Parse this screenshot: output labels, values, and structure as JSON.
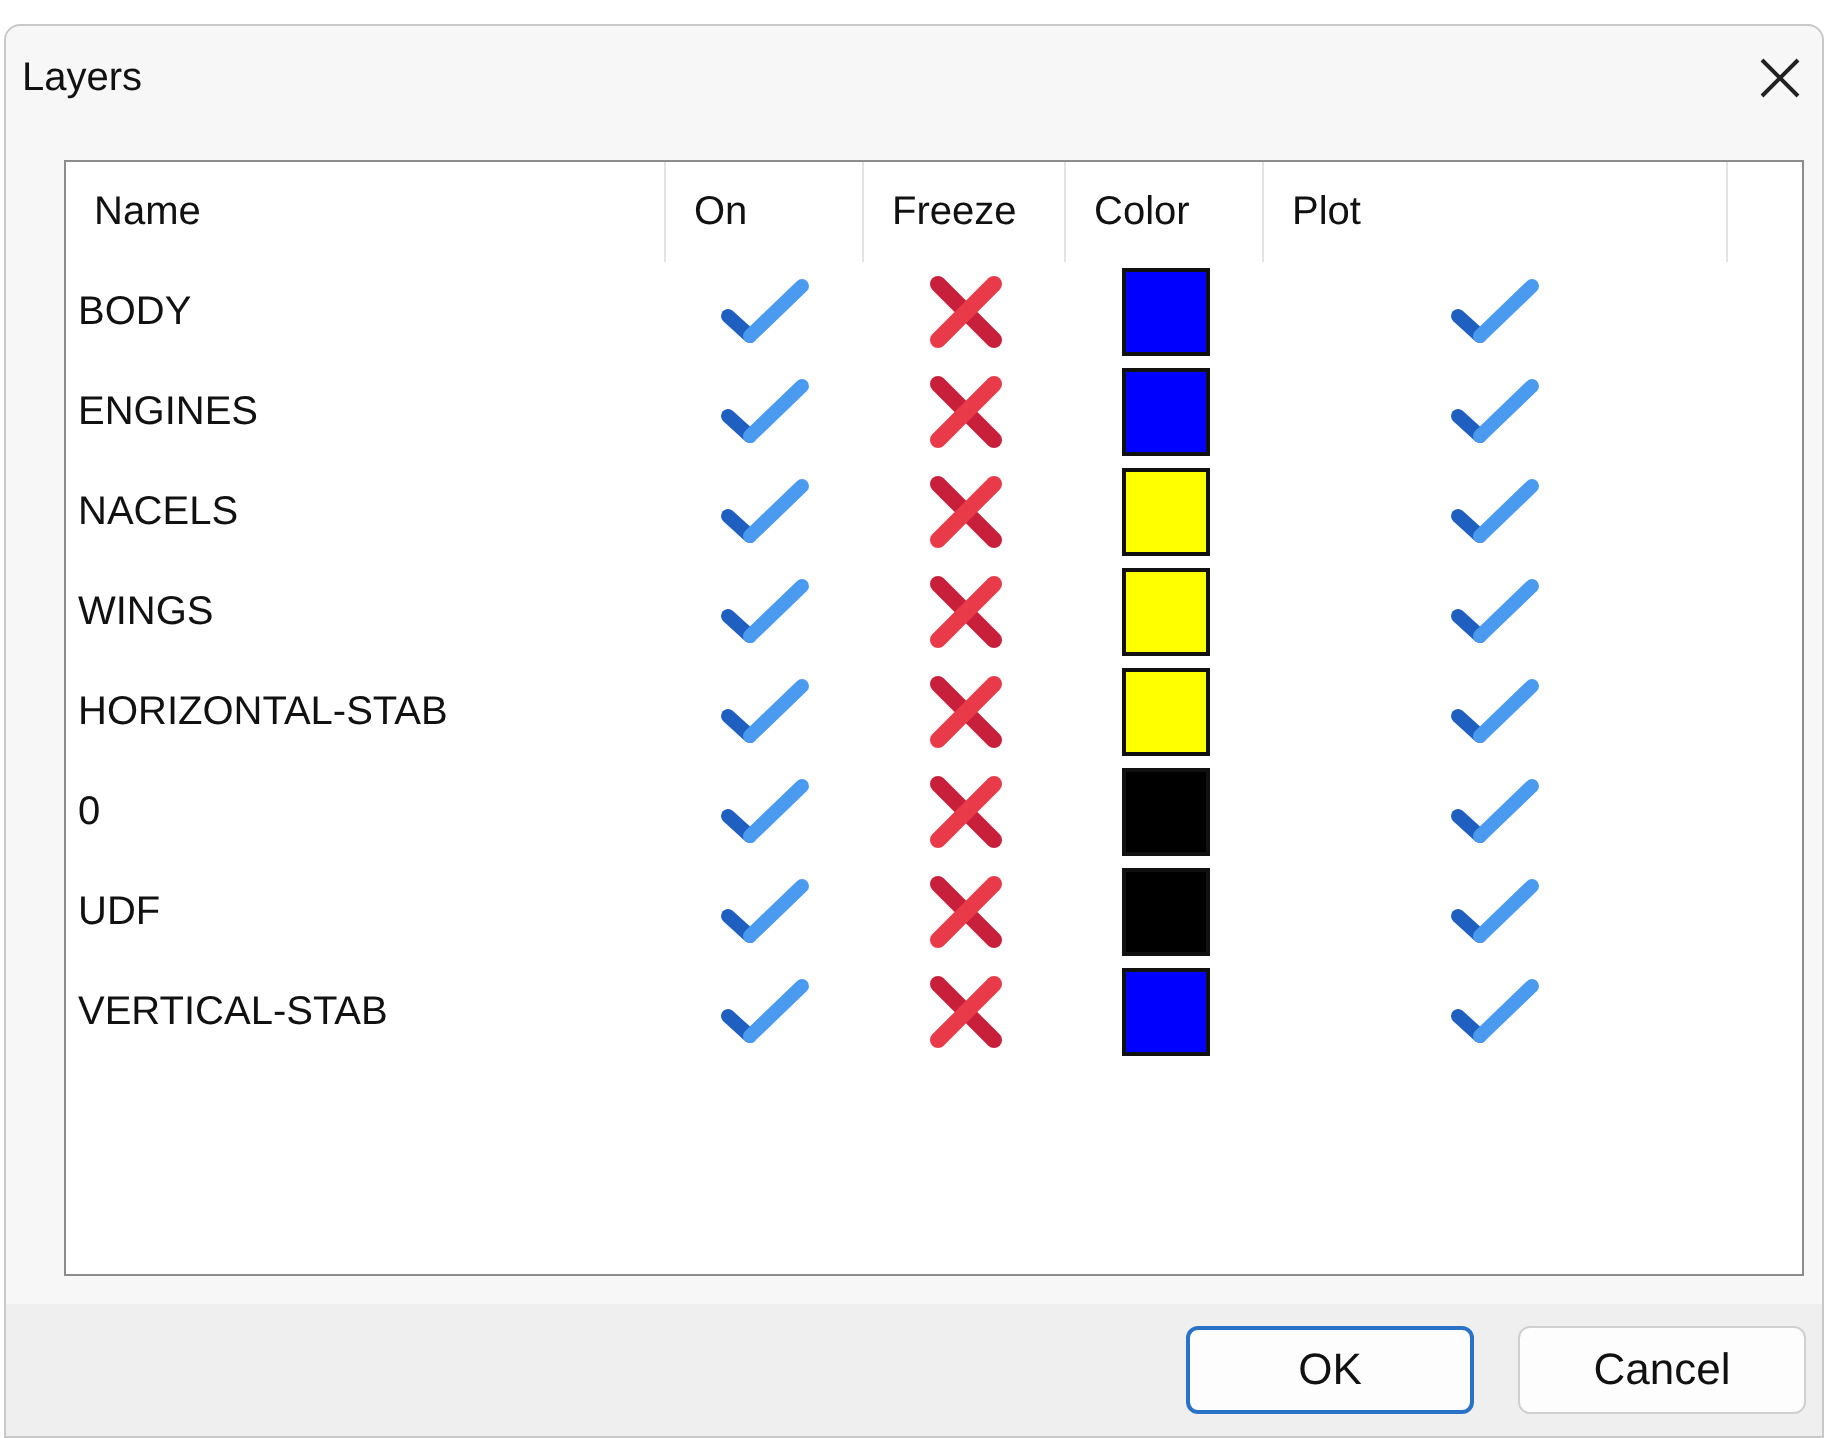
{
  "window": {
    "title": "Layers"
  },
  "table": {
    "columns": [
      "Name",
      "On",
      "Freeze",
      "Color",
      "Plot"
    ],
    "rows": [
      {
        "name": "BODY",
        "on": true,
        "freeze": false,
        "color": "#0000ff",
        "plot": true
      },
      {
        "name": "ENGINES",
        "on": true,
        "freeze": false,
        "color": "#0000ff",
        "plot": true
      },
      {
        "name": "NACELS",
        "on": true,
        "freeze": false,
        "color": "#ffff00",
        "plot": true
      },
      {
        "name": "WINGS",
        "on": true,
        "freeze": false,
        "color": "#ffff00",
        "plot": true
      },
      {
        "name": "HORIZONTAL-STAB",
        "on": true,
        "freeze": false,
        "color": "#ffff00",
        "plot": true
      },
      {
        "name": "0",
        "on": true,
        "freeze": false,
        "color": "#000000",
        "plot": true
      },
      {
        "name": "UDF",
        "on": true,
        "freeze": false,
        "color": "#000000",
        "plot": true
      },
      {
        "name": "VERTICAL-STAB",
        "on": true,
        "freeze": false,
        "color": "#0000ff",
        "plot": true
      }
    ]
  },
  "buttons": [
    {
      "label": "OK",
      "default": true
    },
    {
      "label": "Cancel",
      "default": false
    }
  ]
}
